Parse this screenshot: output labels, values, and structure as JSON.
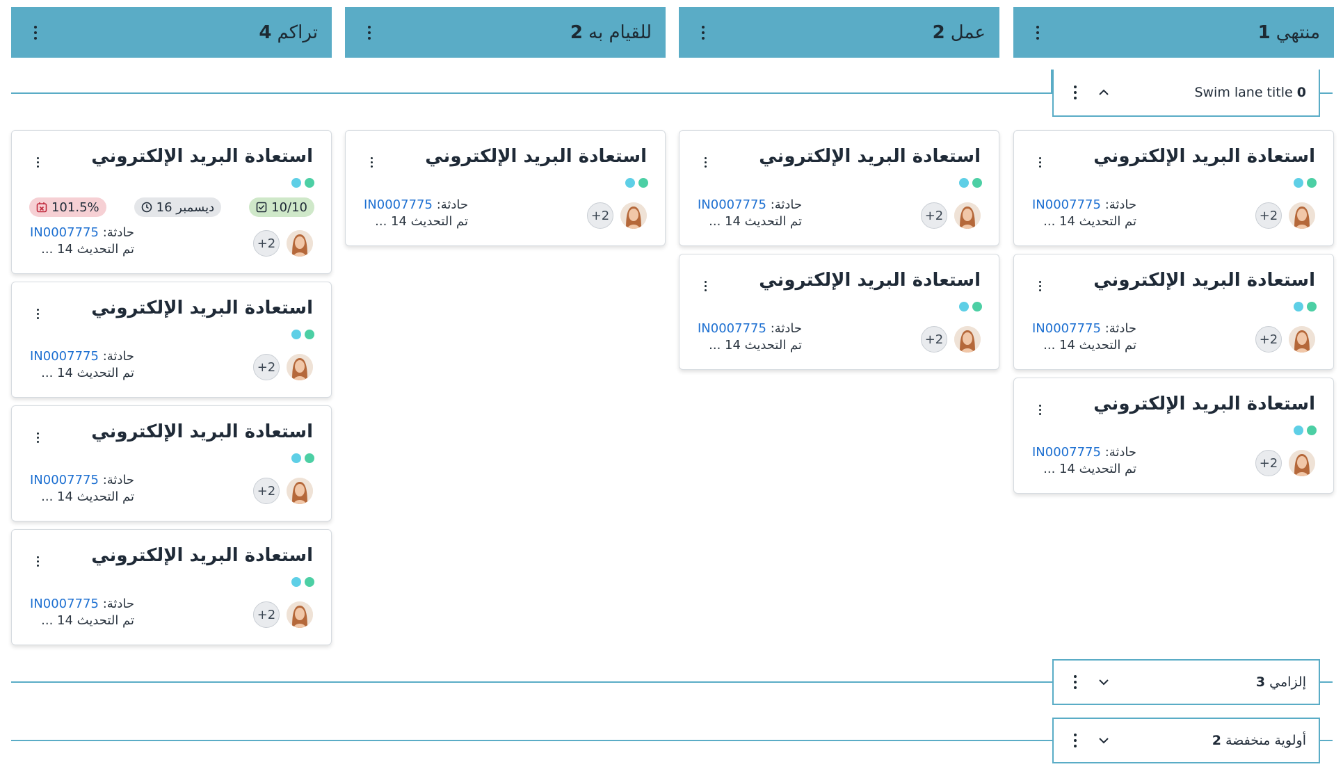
{
  "columns": [
    {
      "title": "منتهي",
      "count": "1"
    },
    {
      "title": "عمل",
      "count": "2"
    },
    {
      "title": "للقيام به",
      "count": "2"
    },
    {
      "title": "تراكم",
      "count": "4"
    }
  ],
  "lanes": [
    {
      "title": "Swim lane title",
      "count": "0"
    },
    {
      "title": "إلزامي",
      "count": "3"
    },
    {
      "title": "أولوية منخفضة",
      "count": "2"
    }
  ],
  "card": {
    "title": "استعادة البريد الإلكتروني",
    "incident_label": "حادثة:",
    "incident_id": "IN0007775",
    "updated": "تم التحديث 14 ...",
    "more_avatars": "+2",
    "dot_colors": [
      "#5ecfe6",
      "#4ccfa4"
    ]
  },
  "badges": {
    "checklist": "10/10",
    "due_date": "16 ديسمبر",
    "sla": "101.5%"
  },
  "colors": {
    "header_bg": "#5aacc6",
    "lane_line": "#5aacc6",
    "link": "#1c6fd1"
  },
  "icons": {
    "column_menu": "kebab-vertical",
    "lane_expand": "chevron-up",
    "lane_collapse": "chevron-down",
    "checklist": "checkbox-icon",
    "due": "clock-icon",
    "sla": "timer-alert-icon"
  }
}
